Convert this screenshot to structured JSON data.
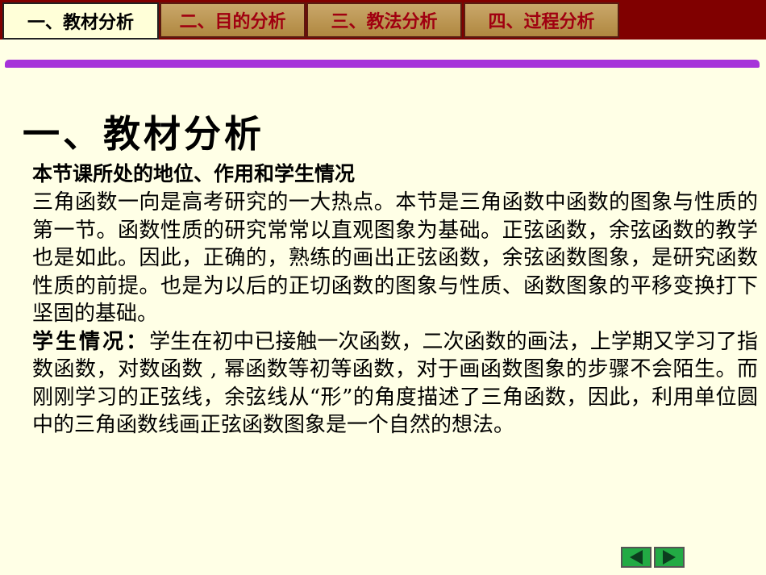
{
  "tabs": [
    {
      "label": "一、教材分析",
      "active": true
    },
    {
      "label": "二、目的分析",
      "active": false
    },
    {
      "label": "三、教法分析",
      "active": false
    },
    {
      "label": "四、过程分析",
      "active": false
    }
  ],
  "page_title": "一、教材分析",
  "section_heading": "本节课所处的地位、作用和学生情况",
  "paragraph1": "三角函数一向是高考研究的一大热点。本节是三角函数中函数的图象与性质的第一节。函数性质的研究常常以直观图象为基础。正弦函数，余弦函数的教学也是如此。因此，正确的，熟练的画出正弦函数，余弦函数图象，是研究函数性质的前提。也是为以后的正切函数的图象与性质、函数图象的平移变换打下坚固的基础。",
  "student_label": "学生情况：",
  "paragraph2": "学生在初中已接触一次函数，二次函数的画法，上学期又学习了指数函数，对数函数 , 幂函数等初等函数，对于画函数图象的步骤不会陌生。而刚刚学习的正弦线，余弦线从“形”的角度描述了三角函数，因此，利用单位圆中的三角函数线画正弦函数图象是一个自然的想法。",
  "nav": {
    "prev_icon": "arrow-left-icon",
    "next_icon": "arrow-right-icon"
  },
  "colors": {
    "topbar": "#800000",
    "accent": "#a633d9",
    "background": "#ffffe6",
    "nav_button": "#22aa44"
  }
}
